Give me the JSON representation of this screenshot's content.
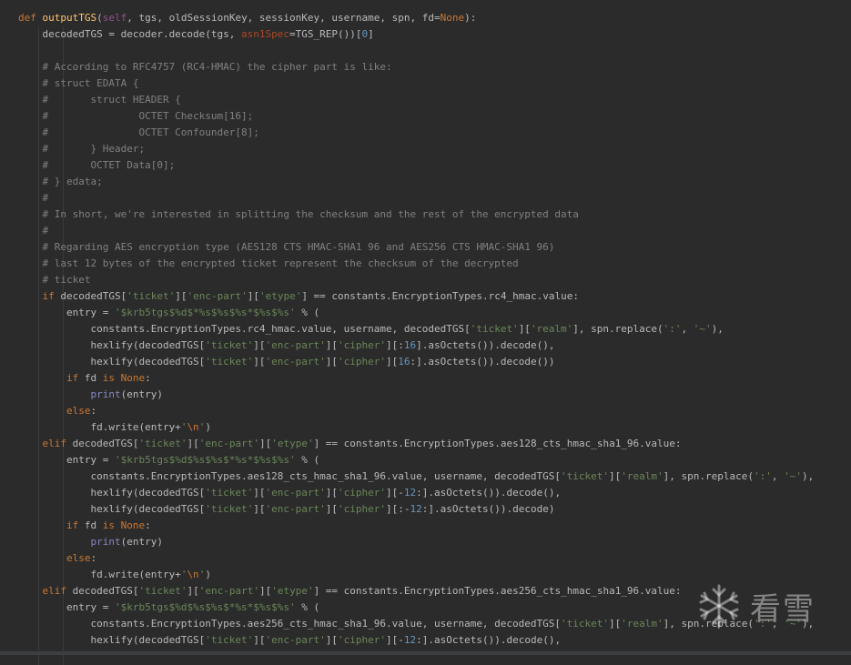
{
  "editor": {
    "language": "python",
    "lines": [
      [
        {
          "t": "def ",
          "c": "kw"
        },
        {
          "t": "outputTGS",
          "c": "fn"
        },
        {
          "t": "(",
          "c": "plain"
        },
        {
          "t": "self",
          "c": "self"
        },
        {
          "t": ", tgs, oldSessionKey, sessionKey, username, spn, fd=",
          "c": "plain"
        },
        {
          "t": "None",
          "c": "kw"
        },
        {
          "t": "):",
          "c": "plain"
        }
      ],
      [
        {
          "t": "    decodedTGS = decoder.decode(tgs, ",
          "c": "plain"
        },
        {
          "t": "asn1Spec",
          "c": "param"
        },
        {
          "t": "=TGS_REP())[",
          "c": "plain"
        },
        {
          "t": "0",
          "c": "num"
        },
        {
          "t": "]",
          "c": "plain"
        }
      ],
      [],
      [
        {
          "t": "    # According to RFC4757 (RC4-HMAC) the cipher part is like:",
          "c": "cmt"
        }
      ],
      [
        {
          "t": "    # struct EDATA {",
          "c": "cmt"
        }
      ],
      [
        {
          "t": "    #       struct HEADER {",
          "c": "cmt"
        }
      ],
      [
        {
          "t": "    #               OCTET Checksum[16];",
          "c": "cmt"
        }
      ],
      [
        {
          "t": "    #               OCTET Confounder[8];",
          "c": "cmt"
        }
      ],
      [
        {
          "t": "    #       } Header;",
          "c": "cmt"
        }
      ],
      [
        {
          "t": "    #       OCTET Data[0];",
          "c": "cmt"
        }
      ],
      [
        {
          "t": "    # } edata;",
          "c": "cmt"
        }
      ],
      [
        {
          "t": "    #",
          "c": "cmt"
        }
      ],
      [
        {
          "t": "    # In short, we're interested in splitting the checksum and the rest of the encrypted data",
          "c": "cmt"
        }
      ],
      [
        {
          "t": "    #",
          "c": "cmt"
        }
      ],
      [
        {
          "t": "    # Regarding AES encryption type (AES128 CTS HMAC-SHA1 96 and AES256 CTS HMAC-SHA1 96)",
          "c": "cmt"
        }
      ],
      [
        {
          "t": "    # last 12 bytes of the encrypted ticket represent the checksum of the decrypted",
          "c": "cmt"
        }
      ],
      [
        {
          "t": "    # ticket",
          "c": "cmt"
        }
      ],
      [
        {
          "t": "    ",
          "c": "plain"
        },
        {
          "t": "if ",
          "c": "kw"
        },
        {
          "t": "decodedTGS[",
          "c": "plain"
        },
        {
          "t": "'ticket'",
          "c": "str"
        },
        {
          "t": "][",
          "c": "plain"
        },
        {
          "t": "'enc-part'",
          "c": "str"
        },
        {
          "t": "][",
          "c": "plain"
        },
        {
          "t": "'etype'",
          "c": "str"
        },
        {
          "t": "] == constants.EncryptionTypes.rc4_hmac.value:",
          "c": "plain"
        }
      ],
      [
        {
          "t": "        entry = ",
          "c": "plain"
        },
        {
          "t": "'$krb5tgs$%d$*%s$%s$%s*$%s$%s'",
          "c": "str"
        },
        {
          "t": " % (",
          "c": "plain"
        }
      ],
      [
        {
          "t": "            constants.EncryptionTypes.rc4_hmac.value, username, decodedTGS[",
          "c": "plain"
        },
        {
          "t": "'ticket'",
          "c": "str"
        },
        {
          "t": "][",
          "c": "plain"
        },
        {
          "t": "'realm'",
          "c": "str"
        },
        {
          "t": "], spn.replace(",
          "c": "plain"
        },
        {
          "t": "':'",
          "c": "str"
        },
        {
          "t": ", ",
          "c": "plain"
        },
        {
          "t": "'~'",
          "c": "str"
        },
        {
          "t": "),",
          "c": "plain"
        }
      ],
      [
        {
          "t": "            hexlify(decodedTGS[",
          "c": "plain"
        },
        {
          "t": "'ticket'",
          "c": "str"
        },
        {
          "t": "][",
          "c": "plain"
        },
        {
          "t": "'enc-part'",
          "c": "str"
        },
        {
          "t": "][",
          "c": "plain"
        },
        {
          "t": "'cipher'",
          "c": "str"
        },
        {
          "t": "][:",
          "c": "plain"
        },
        {
          "t": "16",
          "c": "num"
        },
        {
          "t": "].asOctets()).decode(),",
          "c": "plain"
        }
      ],
      [
        {
          "t": "            hexlify(decodedTGS[",
          "c": "plain"
        },
        {
          "t": "'ticket'",
          "c": "str"
        },
        {
          "t": "][",
          "c": "plain"
        },
        {
          "t": "'enc-part'",
          "c": "str"
        },
        {
          "t": "][",
          "c": "plain"
        },
        {
          "t": "'cipher'",
          "c": "str"
        },
        {
          "t": "][",
          "c": "plain"
        },
        {
          "t": "16",
          "c": "num"
        },
        {
          "t": ":].asOctets()).decode())",
          "c": "plain"
        }
      ],
      [
        {
          "t": "        ",
          "c": "plain"
        },
        {
          "t": "if ",
          "c": "kw"
        },
        {
          "t": "fd ",
          "c": "plain"
        },
        {
          "t": "is None",
          "c": "kw"
        },
        {
          "t": ":",
          "c": "plain"
        }
      ],
      [
        {
          "t": "            ",
          "c": "plain"
        },
        {
          "t": "print",
          "c": "builtin"
        },
        {
          "t": "(entry)",
          "c": "plain"
        }
      ],
      [
        {
          "t": "        ",
          "c": "plain"
        },
        {
          "t": "else",
          "c": "kw"
        },
        {
          "t": ":",
          "c": "plain"
        }
      ],
      [
        {
          "t": "            fd.write(entry+",
          "c": "plain"
        },
        {
          "t": "'",
          "c": "str"
        },
        {
          "t": "\\n",
          "c": "esc"
        },
        {
          "t": "'",
          "c": "str"
        },
        {
          "t": ")",
          "c": "plain"
        }
      ],
      [
        {
          "t": "    ",
          "c": "plain"
        },
        {
          "t": "elif ",
          "c": "kw"
        },
        {
          "t": "decodedTGS[",
          "c": "plain"
        },
        {
          "t": "'ticket'",
          "c": "str"
        },
        {
          "t": "][",
          "c": "plain"
        },
        {
          "t": "'enc-part'",
          "c": "str"
        },
        {
          "t": "][",
          "c": "plain"
        },
        {
          "t": "'etype'",
          "c": "str"
        },
        {
          "t": "] == constants.EncryptionTypes.aes128_cts_hmac_sha1_96.value:",
          "c": "plain"
        }
      ],
      [
        {
          "t": "        entry = ",
          "c": "plain"
        },
        {
          "t": "'$krb5tgs$%d$%s$%s$*%s*$%s$%s'",
          "c": "str"
        },
        {
          "t": " % (",
          "c": "plain"
        }
      ],
      [
        {
          "t": "            constants.EncryptionTypes.aes128_cts_hmac_sha1_96.value, username, decodedTGS[",
          "c": "plain"
        },
        {
          "t": "'ticket'",
          "c": "str"
        },
        {
          "t": "][",
          "c": "plain"
        },
        {
          "t": "'realm'",
          "c": "str"
        },
        {
          "t": "], spn.replace(",
          "c": "plain"
        },
        {
          "t": "':'",
          "c": "str"
        },
        {
          "t": ", ",
          "c": "plain"
        },
        {
          "t": "'~'",
          "c": "str"
        },
        {
          "t": "),",
          "c": "plain"
        }
      ],
      [
        {
          "t": "            hexlify(decodedTGS[",
          "c": "plain"
        },
        {
          "t": "'ticket'",
          "c": "str"
        },
        {
          "t": "][",
          "c": "plain"
        },
        {
          "t": "'enc-part'",
          "c": "str"
        },
        {
          "t": "][",
          "c": "plain"
        },
        {
          "t": "'cipher'",
          "c": "str"
        },
        {
          "t": "][-",
          "c": "plain"
        },
        {
          "t": "12",
          "c": "num"
        },
        {
          "t": ":].asOctets()).decode(),",
          "c": "plain"
        }
      ],
      [
        {
          "t": "            hexlify(decodedTGS[",
          "c": "plain"
        },
        {
          "t": "'ticket'",
          "c": "str"
        },
        {
          "t": "][",
          "c": "plain"
        },
        {
          "t": "'enc-part'",
          "c": "str"
        },
        {
          "t": "][",
          "c": "plain"
        },
        {
          "t": "'cipher'",
          "c": "str"
        },
        {
          "t": "][:-",
          "c": "plain"
        },
        {
          "t": "12",
          "c": "num"
        },
        {
          "t": ":].asOctets()).decode)",
          "c": "plain"
        }
      ],
      [
        {
          "t": "        ",
          "c": "plain"
        },
        {
          "t": "if ",
          "c": "kw"
        },
        {
          "t": "fd ",
          "c": "plain"
        },
        {
          "t": "is None",
          "c": "kw"
        },
        {
          "t": ":",
          "c": "plain"
        }
      ],
      [
        {
          "t": "            ",
          "c": "plain"
        },
        {
          "t": "print",
          "c": "builtin"
        },
        {
          "t": "(entry)",
          "c": "plain"
        }
      ],
      [
        {
          "t": "        ",
          "c": "plain"
        },
        {
          "t": "else",
          "c": "kw"
        },
        {
          "t": ":",
          "c": "plain"
        }
      ],
      [
        {
          "t": "            fd.write(entry+",
          "c": "plain"
        },
        {
          "t": "'",
          "c": "str"
        },
        {
          "t": "\\n",
          "c": "esc"
        },
        {
          "t": "'",
          "c": "str"
        },
        {
          "t": ")",
          "c": "plain"
        }
      ],
      [
        {
          "t": "    ",
          "c": "plain"
        },
        {
          "t": "elif ",
          "c": "kw"
        },
        {
          "t": "decodedTGS[",
          "c": "plain"
        },
        {
          "t": "'ticket'",
          "c": "str"
        },
        {
          "t": "][",
          "c": "plain"
        },
        {
          "t": "'enc-part'",
          "c": "str"
        },
        {
          "t": "][",
          "c": "plain"
        },
        {
          "t": "'etype'",
          "c": "str"
        },
        {
          "t": "] == constants.EncryptionTypes.aes256_cts_hmac_sha1_96.value:",
          "c": "plain"
        }
      ],
      [
        {
          "t": "        entry = ",
          "c": "plain"
        },
        {
          "t": "'$krb5tgs$%d$%s$%s$*%s*$%s$%s'",
          "c": "str"
        },
        {
          "t": " % (",
          "c": "plain"
        }
      ],
      [
        {
          "t": "            constants.EncryptionTypes.aes256_cts_hmac_sha1_96.value, username, decodedTGS[",
          "c": "plain"
        },
        {
          "t": "'ticket'",
          "c": "str"
        },
        {
          "t": "][",
          "c": "plain"
        },
        {
          "t": "'realm'",
          "c": "str"
        },
        {
          "t": "], spn.replace(",
          "c": "plain"
        },
        {
          "t": "':'",
          "c": "str"
        },
        {
          "t": ", ",
          "c": "plain"
        },
        {
          "t": "'~'",
          "c": "str"
        },
        {
          "t": "),",
          "c": "plain"
        }
      ],
      [
        {
          "t": "            hexlify(decodedTGS[",
          "c": "plain"
        },
        {
          "t": "'ticket'",
          "c": "str"
        },
        {
          "t": "][",
          "c": "plain"
        },
        {
          "t": "'enc-part'",
          "c": "str"
        },
        {
          "t": "][",
          "c": "plain"
        },
        {
          "t": "'cipher'",
          "c": "str"
        },
        {
          "t": "][-",
          "c": "plain"
        },
        {
          "t": "12",
          "c": "num"
        },
        {
          "t": ":].asOctets()).decode(),",
          "c": "plain"
        }
      ]
    ]
  },
  "watermark": {
    "text": "看雪",
    "icon": "snowflake-icon"
  }
}
